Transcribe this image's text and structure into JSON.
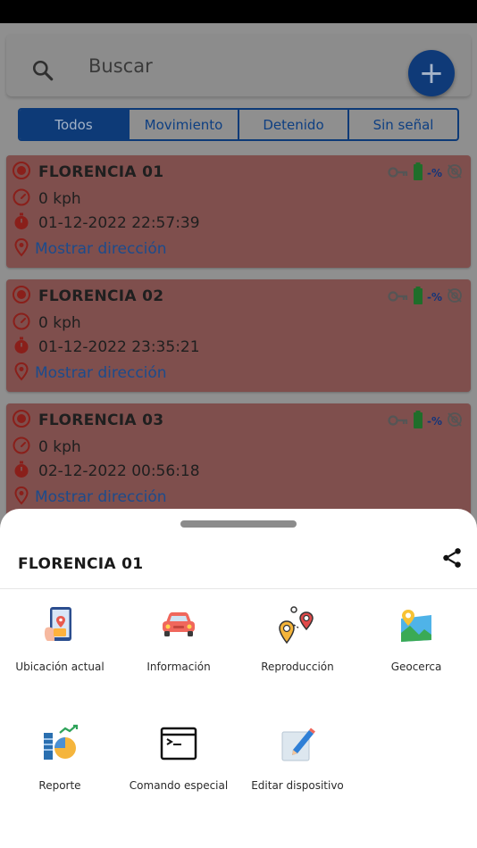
{
  "search": {
    "placeholder": "Buscar"
  },
  "fab": {
    "label": "+"
  },
  "tabs": [
    {
      "label": "Todos",
      "active": true
    },
    {
      "label": "Movimiento",
      "active": false
    },
    {
      "label": "Detenido",
      "active": false
    },
    {
      "label": "Sin señal",
      "active": false
    }
  ],
  "devices": [
    {
      "name": "FLORENCIA 01",
      "speed": "0 kph",
      "datetime": "01-12-2022 22:57:39",
      "address_link": "Mostrar dirección",
      "battery_pct": "-%"
    },
    {
      "name": "FLORENCIA 02",
      "speed": "0 kph",
      "datetime": "01-12-2022 23:35:21",
      "address_link": "Mostrar dirección",
      "battery_pct": "-%"
    },
    {
      "name": "FLORENCIA 03",
      "speed": "0 kph",
      "datetime": "02-12-2022 00:56:18",
      "address_link": "Mostrar dirección",
      "battery_pct": "-%"
    }
  ],
  "sheet": {
    "title": "FLORENCIA 01",
    "actions": [
      {
        "label": "Ubicación actual",
        "icon": "phone-location-icon"
      },
      {
        "label": "Información",
        "icon": "car-icon"
      },
      {
        "label": "Reproducción",
        "icon": "route-pins-icon"
      },
      {
        "label": "Geocerca",
        "icon": "map-pin-icon"
      },
      {
        "label": "Reporte",
        "icon": "report-chart-icon"
      },
      {
        "label": "Comando especial",
        "icon": "terminal-icon"
      },
      {
        "label": "Editar dispositivo",
        "icon": "edit-note-icon"
      }
    ]
  },
  "colors": {
    "primary": "#0d3a77",
    "card_bg": "#7f4f4d",
    "link": "#1c4b8c",
    "battery": "#1f6e2a",
    "record_icon": "#8a1f1a"
  }
}
